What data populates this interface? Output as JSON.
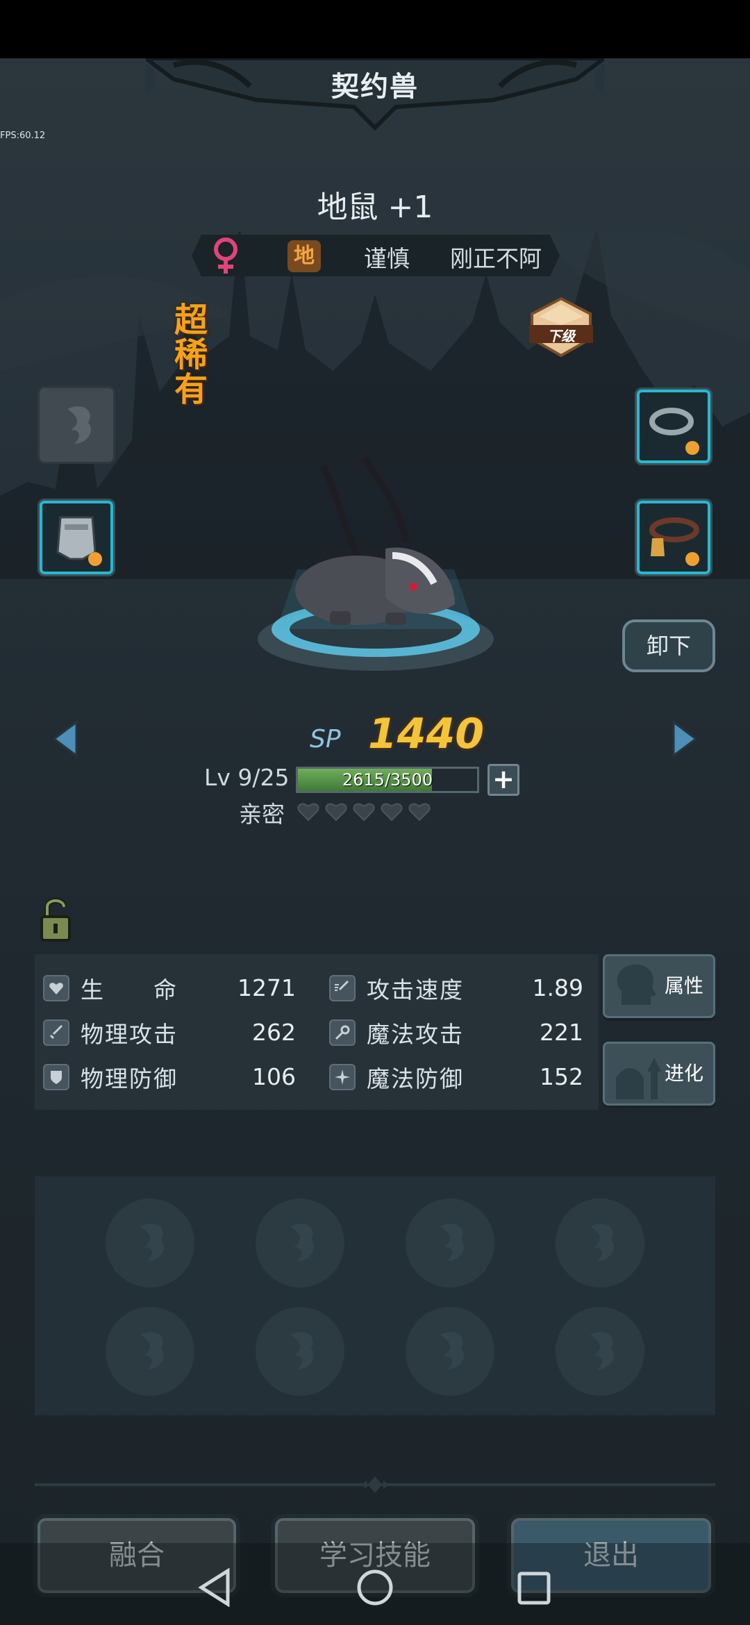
{
  "header": {
    "title": "契约兽",
    "fps": "FPS:60.12"
  },
  "pet": {
    "name": "地鼠 +1",
    "element": "地",
    "trait1": "谨慎",
    "trait2": "刚正不阿",
    "rarity": "超稀有",
    "grade": "下级",
    "unequip_label": "卸下",
    "sp_label": "SP",
    "sp_value": "1440",
    "level": "Lv 9/25",
    "xp_text": "2615/3500",
    "xp_progress": 0.747,
    "intimacy_label": "亲密",
    "intimacy_hearts_filled": 0,
    "intimacy_hearts_total": 5
  },
  "stats": {
    "hp_label": "生　　命",
    "hp_value": "1271",
    "atk_speed_label": "攻击速度",
    "atk_speed_value": "1.89",
    "phys_atk_label": "物理攻击",
    "phys_atk_value": "262",
    "magic_atk_label": "魔法攻击",
    "magic_atk_value": "221",
    "phys_def_label": "物理防御",
    "phys_def_value": "106",
    "magic_def_label": "魔法防御",
    "magic_def_value": "152"
  },
  "side_buttons": {
    "attributes": "属性",
    "evolve": "进化"
  },
  "bottom_buttons": {
    "fuse": "融合",
    "learn_skill": "学习技能",
    "exit": "退出"
  },
  "colors": {
    "accent_cyan": "#27b8cf",
    "rarity_orange": "#f2a31d",
    "sp_gold": "#f4c53a",
    "gender_pink": "#e0447a"
  }
}
